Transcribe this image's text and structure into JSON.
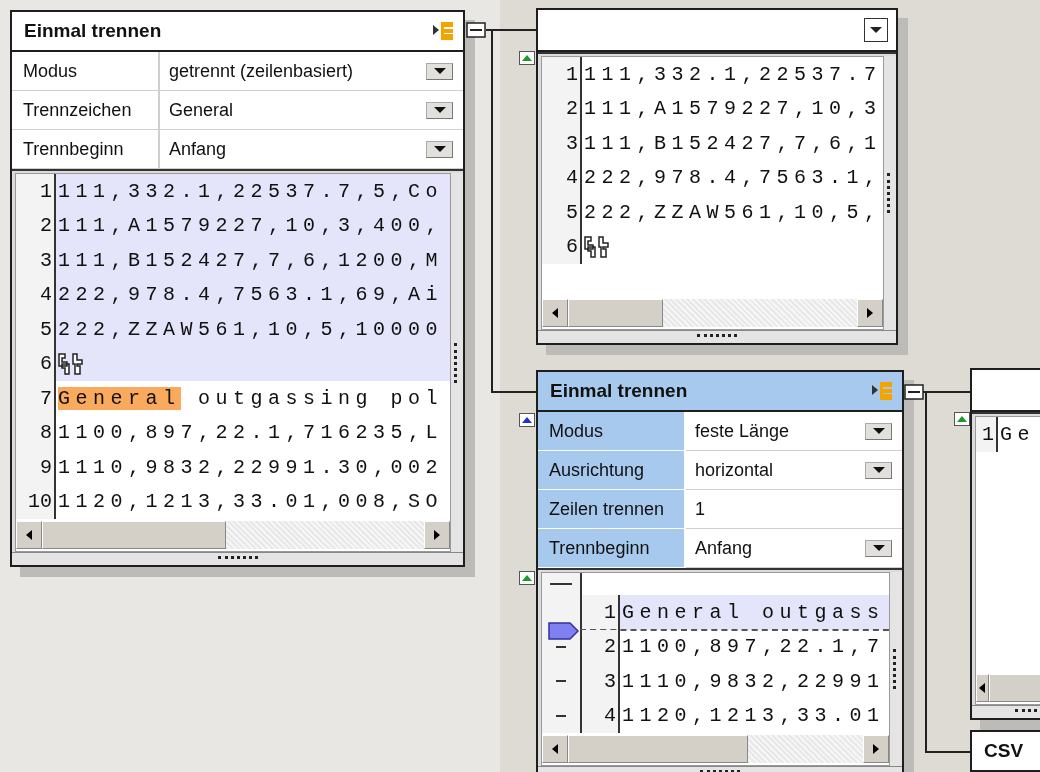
{
  "nodes": [
    {
      "kind": "split",
      "title": "Einmal trennen",
      "selected": false,
      "properties": [
        {
          "label": "Modus",
          "value": "getrennt (zeilenbasiert)",
          "kind": "dropdown"
        },
        {
          "label": "Trennzeichen",
          "value": "General",
          "kind": "dropdown"
        },
        {
          "label": "Trennbeginn",
          "value": "Anfang",
          "kind": "dropdown"
        }
      ],
      "lines": [
        {
          "number": "1",
          "text": "111,332.1,22537.7,5,Co",
          "selected": true
        },
        {
          "number": "2",
          "text": "111,A1579227,10,3,400,",
          "selected": true
        },
        {
          "number": "3",
          "text": "111,B152427,7,6,1200,M",
          "selected": true
        },
        {
          "number": "4",
          "text": "222,978.4,7563.1,69,Ai",
          "selected": true
        },
        {
          "number": "5",
          "text": "222,ZZAW561,10,5,10000",
          "selected": true
        },
        {
          "number": "6",
          "kind": "line-break",
          "selected": true
        },
        {
          "number": "7",
          "match": "General",
          "text": " outgassing pol",
          "selected": false
        },
        {
          "number": "8",
          "text": "1100,897,22.1,716235,L",
          "selected": false
        },
        {
          "number": "9",
          "text": "1110,9832,22991.30,002",
          "selected": false
        },
        {
          "number": "10",
          "text": "1120,1213,33.01,008,SO",
          "selected": false
        }
      ]
    },
    {
      "kind": "viewer",
      "lines": [
        {
          "number": "1",
          "text": "111,332.1,22537.7",
          "selected": false
        },
        {
          "number": "2",
          "text": "111,A1579227,10,3",
          "selected": false
        },
        {
          "number": "3",
          "text": "111,B152427,7,6,1",
          "selected": false
        },
        {
          "number": "4",
          "text": "222,978.4,7563.1,",
          "selected": false
        },
        {
          "number": "5",
          "text": "222,ZZAW561,10,5,",
          "selected": false
        },
        {
          "number": "6",
          "kind": "line-break",
          "selected": false
        }
      ]
    },
    {
      "kind": "split",
      "title": "Einmal trennen",
      "selected": true,
      "properties": [
        {
          "label": "Modus",
          "value": "feste Länge",
          "kind": "dropdown"
        },
        {
          "label": "Ausrichtung",
          "value": "horizontal",
          "kind": "dropdown"
        },
        {
          "label": "Zeilen trennen",
          "value": "1",
          "kind": "text"
        },
        {
          "label": "Trennbeginn",
          "value": "Anfang",
          "kind": "dropdown"
        }
      ],
      "lines": [
        {
          "number": "1",
          "text": "General outgass",
          "selected": true,
          "split_below": true
        },
        {
          "number": "2",
          "text": "1100,897,22.1,7",
          "selected": false,
          "split_below": false
        },
        {
          "number": "3",
          "text": "1110,9832,22991",
          "selected": false,
          "split_below": false
        },
        {
          "number": "4",
          "text": "1120,1213,33.01",
          "selected": false,
          "split_below": false
        }
      ]
    },
    {
      "kind": "viewer",
      "lines": [
        {
          "number": "1",
          "text": "Ge",
          "selected": false
        }
      ]
    },
    {
      "kind": "output",
      "title": "CSV"
    }
  ]
}
